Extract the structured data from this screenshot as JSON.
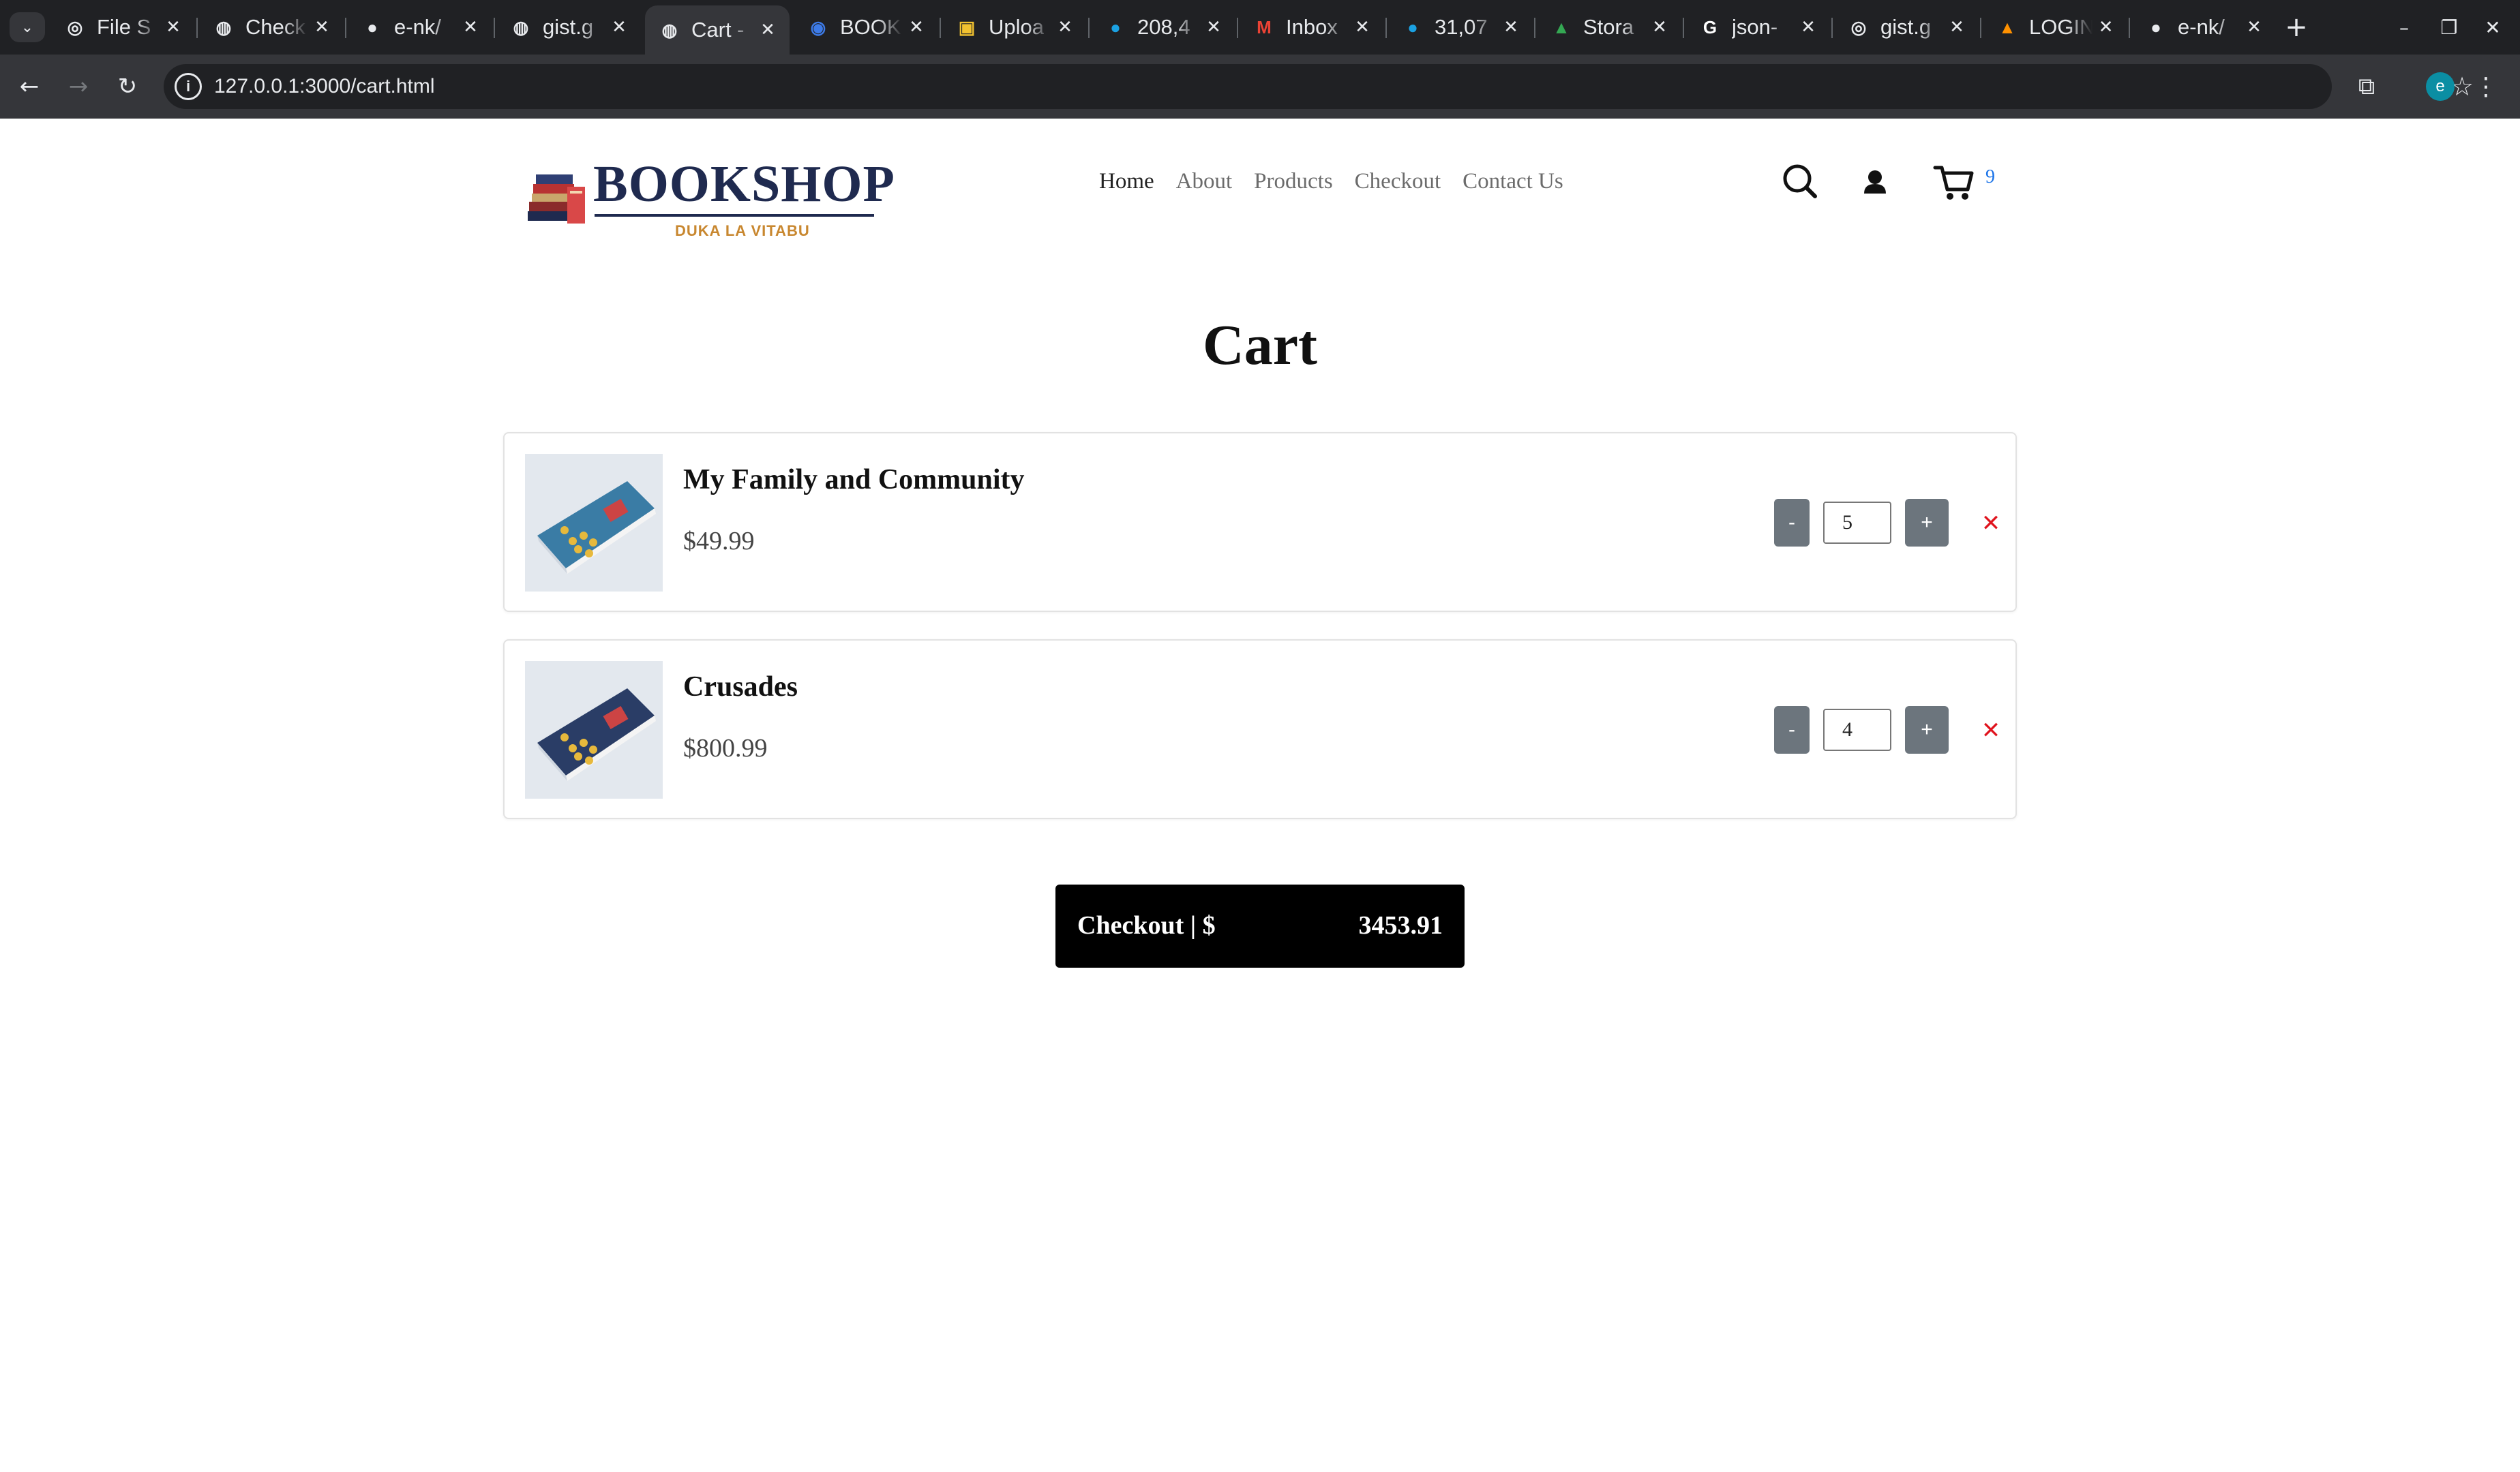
{
  "browser": {
    "tabs": [
      {
        "title": "File S",
        "favicon": "openai-icon",
        "color": "#e8eaed"
      },
      {
        "title": "Check",
        "favicon": "globe-icon",
        "color": "#e8eaed"
      },
      {
        "title": "e-nk/",
        "favicon": "github-icon",
        "color": "#e8eaed"
      },
      {
        "title": "gist.g",
        "favicon": "globe-icon",
        "color": "#e8eaed"
      },
      {
        "title": "Cart -",
        "favicon": "globe-icon",
        "color": "#e8eaed",
        "active": true
      },
      {
        "title": "BOOK",
        "favicon": "circle-logo-icon",
        "color": "#3d7be8"
      },
      {
        "title": "Uploa",
        "favicon": "upload-icon",
        "color": "#f2c230"
      },
      {
        "title": "208,4",
        "favicon": "search-badge-icon",
        "color": "#1ba1e2"
      },
      {
        "title": "Inbox",
        "favicon": "gmail-icon",
        "color": "#ea4335"
      },
      {
        "title": "31,07",
        "favicon": "search-badge-icon",
        "color": "#1ba1e2"
      },
      {
        "title": "Stora",
        "favicon": "drive-icon",
        "color": "#34a853"
      },
      {
        "title": "json-",
        "favicon": "google-icon",
        "color": "#ffffff"
      },
      {
        "title": "gist.g",
        "favicon": "openai-icon",
        "color": "#e8eaed"
      },
      {
        "title": "LOGIN",
        "favicon": "firebase-icon",
        "color": "#ff9100"
      },
      {
        "title": "e-nk/",
        "favicon": "github-icon",
        "color": "#e8eaed"
      }
    ],
    "url": "127.0.0.1:3000/cart.html",
    "profile_initial": "e"
  },
  "site": {
    "logo_title": "BOOKSHOP",
    "logo_subtitle": "DUKA LA VITABU",
    "nav": [
      "Home",
      "About",
      "Products",
      "Checkout",
      "Contact Us"
    ],
    "active_nav": "Home",
    "cart_count": "9"
  },
  "page_title": "Cart",
  "cart": {
    "items": [
      {
        "name": "My Family and Community",
        "price": "$49.99",
        "quantity": "5",
        "cover_color": "#3a7ca5"
      },
      {
        "name": "Crusades",
        "price": "$800.99",
        "quantity": "4",
        "cover_color": "#2a3d66"
      }
    ],
    "minus_label": "-",
    "plus_label": "+",
    "remove_label": "✕"
  },
  "checkout": {
    "label": "Checkout | $",
    "total": "3453.91"
  },
  "colors": {
    "accent_blue": "#1a73e8",
    "remove_red": "#e0141e",
    "qty_button": "#6c757d",
    "checkout_bg": "#000000",
    "logo_navy": "#1f2a4f",
    "logo_gold": "#c8872f"
  }
}
